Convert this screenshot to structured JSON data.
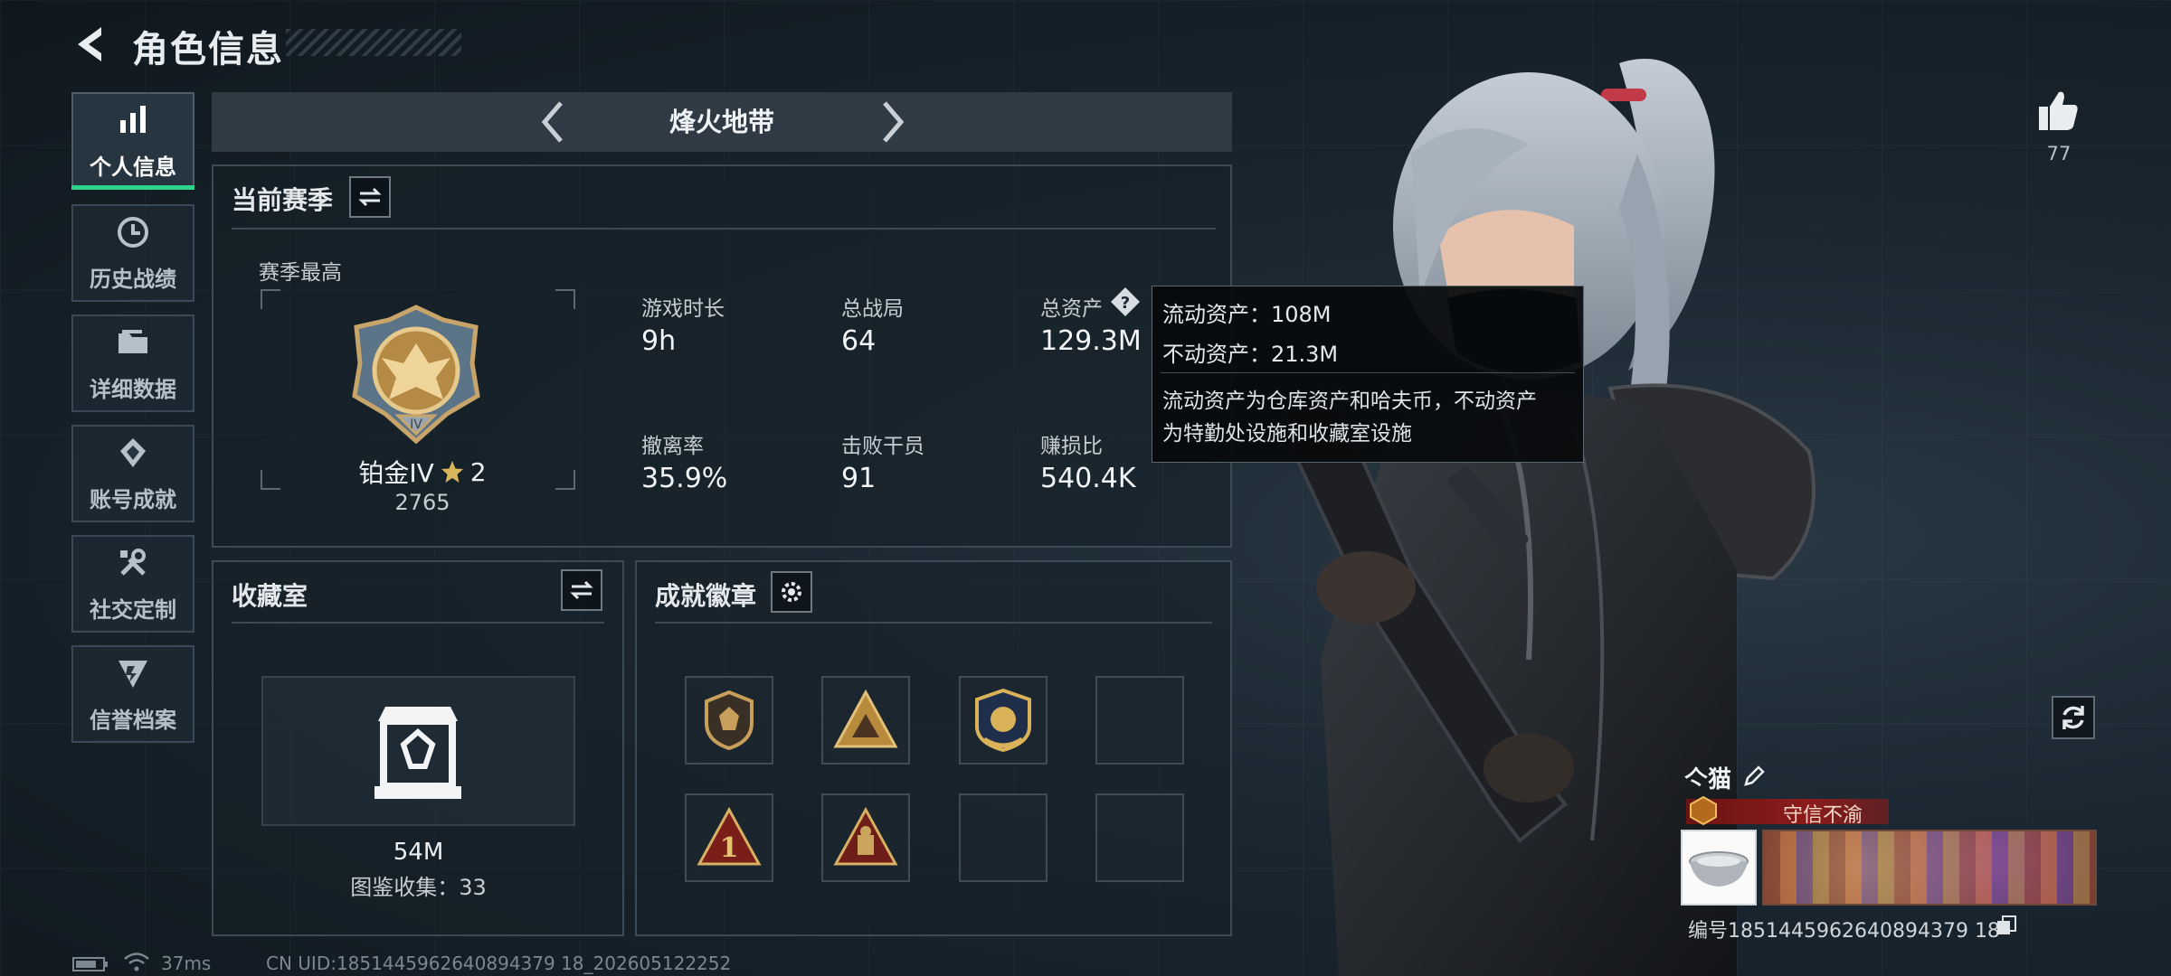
{
  "header": {
    "title": "角色信息"
  },
  "sidebar": {
    "items": [
      {
        "label": "个人信息",
        "icon": "bar-chart-icon",
        "active": true
      },
      {
        "label": "历史战绩",
        "icon": "history-icon"
      },
      {
        "label": "详细数据",
        "icon": "folder-icon"
      },
      {
        "label": "账号成就",
        "icon": "achievement-icon"
      },
      {
        "label": "社交定制",
        "icon": "tools-icon"
      },
      {
        "label": "信誉档案",
        "icon": "credit-icon"
      }
    ]
  },
  "mode": {
    "label": "烽火地带"
  },
  "season": {
    "title": "当前赛季",
    "best_label": "赛季最高",
    "rank": "铂金IV",
    "rank_stars": "2",
    "score": "2765",
    "stats": [
      {
        "label": "游戏时长",
        "value": "9h"
      },
      {
        "label": "总战局",
        "value": "64"
      },
      {
        "label": "总资产",
        "value": "129.3M"
      },
      {
        "label": "撤离率",
        "value": "35.9%"
      },
      {
        "label": "击败干员",
        "value": "91"
      },
      {
        "label": "赚损比",
        "value": "540.4K"
      }
    ]
  },
  "tooltip": {
    "liquid": "流动资产：108M",
    "fixed": "不动资产：21.3M",
    "desc_line1": "流动资产为仓库资产和哈夫币，不动资产",
    "desc_line2": "为特勤处设施和收藏室设施"
  },
  "collection": {
    "title": "收藏室",
    "value": "54M",
    "count_text": "图鉴收集：33"
  },
  "badges": {
    "title": "成就徽章",
    "slots": [
      "badge-shield",
      "badge-triangle",
      "badge-emblem",
      "empty",
      "badge-number-one",
      "badge-triangle-2",
      "empty",
      "empty"
    ]
  },
  "profile": {
    "likes": "77",
    "name": "亽猫",
    "title_text": "守信不渝",
    "id_text": "编号1851445962640894379 18"
  },
  "footer": {
    "ping": "37ms",
    "uid": "CN UID:1851445962640894379 18_202605122252"
  },
  "colors": {
    "accent": "#2fd48c",
    "tooltip_bg": "#08090b",
    "banner": "#8c1b1b"
  }
}
